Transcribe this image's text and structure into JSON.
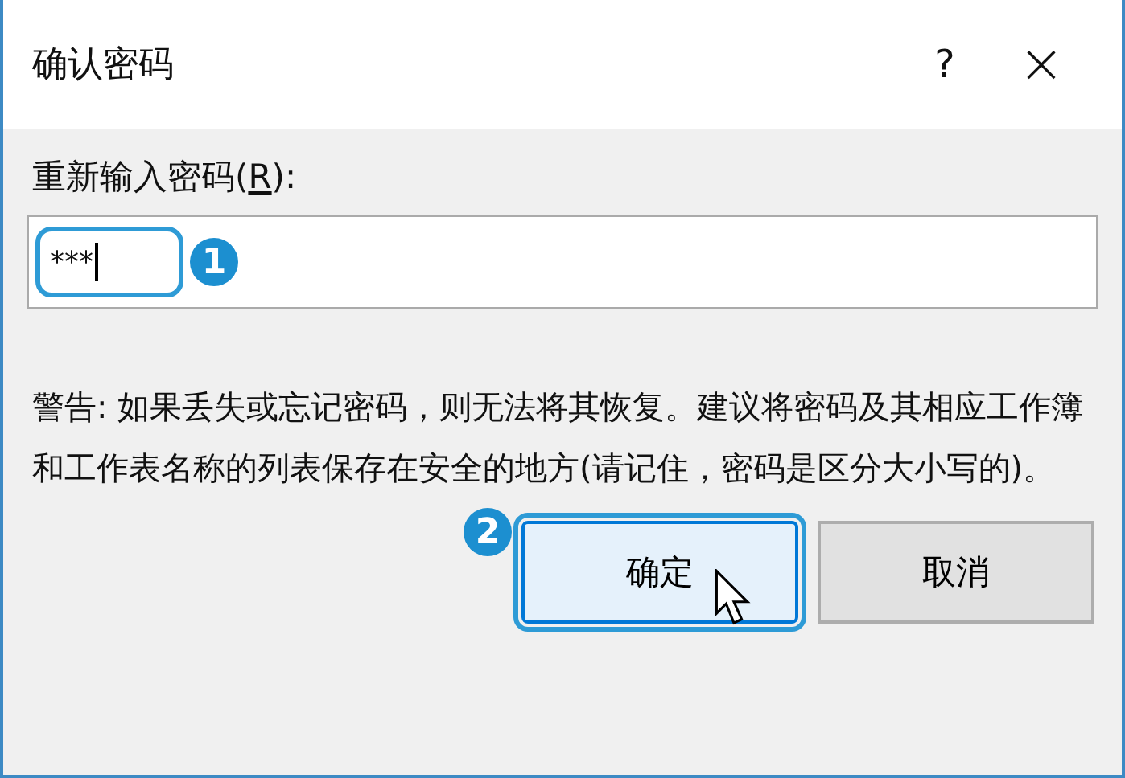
{
  "window": {
    "title": "确认密码",
    "help": "?",
    "close": "×"
  },
  "field": {
    "label_before": "重新输入密码(",
    "access_key": "R",
    "label_after": "):",
    "value": "***",
    "highlighted": true,
    "callout": "1"
  },
  "warning": "警告: 如果丢失或忘记密码，则无法将其恢复。建议将密码及其相应工作簿和工作表名称的列表保存在安全的地方(请记住，密码是区分大小写的)。",
  "buttons": [
    {
      "label": "确定",
      "default": true,
      "highlighted": true,
      "callout": "2"
    },
    {
      "label": "取消",
      "default": false,
      "highlighted": false
    }
  ]
}
